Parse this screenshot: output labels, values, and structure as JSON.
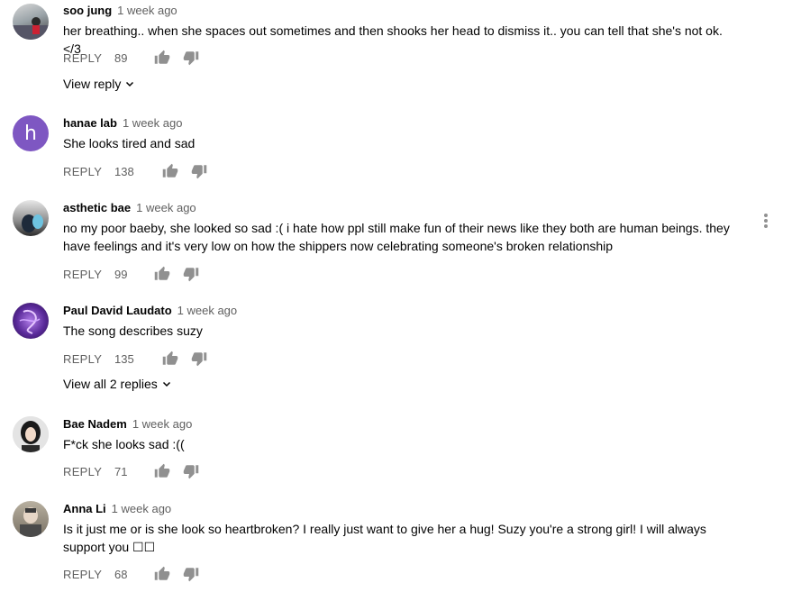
{
  "comments": [
    {
      "author": "soo jung",
      "time": "1 week ago",
      "text": "her breathing.. when she spaces out sometimes and then shooks her head to dismiss it.. you can tell that she's not ok. </3",
      "reply_label": "REPLY",
      "likes": "89",
      "avatar_icon": "photo-avatar",
      "view_replies": "View reply"
    },
    {
      "author": "hanae lab",
      "time": "1 week ago",
      "text": "She looks tired and sad",
      "reply_label": "REPLY",
      "likes": "138",
      "avatar_letter": "h",
      "avatar_color": "#7e57c2"
    },
    {
      "author": "asthetic bae",
      "time": "1 week ago",
      "text": "no my poor baeby, she looked so sad :( i hate how ppl still make fun of their news like they both are human beings. they have feelings and it's very low on how the shippers now celebrating someone's broken relationship",
      "reply_label": "REPLY",
      "likes": "99",
      "avatar_icon": "photo-avatar"
    },
    {
      "author": "Paul David Laudato",
      "time": "1 week ago",
      "text": "The song describes suzy",
      "reply_label": "REPLY",
      "likes": "135",
      "avatar_icon": "neon-avatar",
      "view_replies": "View all 2 replies"
    },
    {
      "author": "Bae Nadem",
      "time": "1 week ago",
      "text": "F*ck she looks sad :((",
      "reply_label": "REPLY",
      "likes": "71",
      "avatar_icon": "photo-avatar"
    },
    {
      "author": "Anna Li",
      "time": "1 week ago",
      "text": "Is it just me or is she look so heartbroken? I really just want to give her a hug! Suzy you're a strong girl! I will always support you ☐☐",
      "reply_label": "REPLY",
      "likes": "68",
      "avatar_icon": "photo-avatar"
    }
  ],
  "icons": {
    "like": "thumbs-up-icon",
    "dislike": "thumbs-down-icon",
    "more": "more-vert-icon",
    "expand": "chevron-down-icon"
  },
  "colors": {
    "text": "#030303",
    "secondary": "#606060",
    "icon": "#909090"
  }
}
